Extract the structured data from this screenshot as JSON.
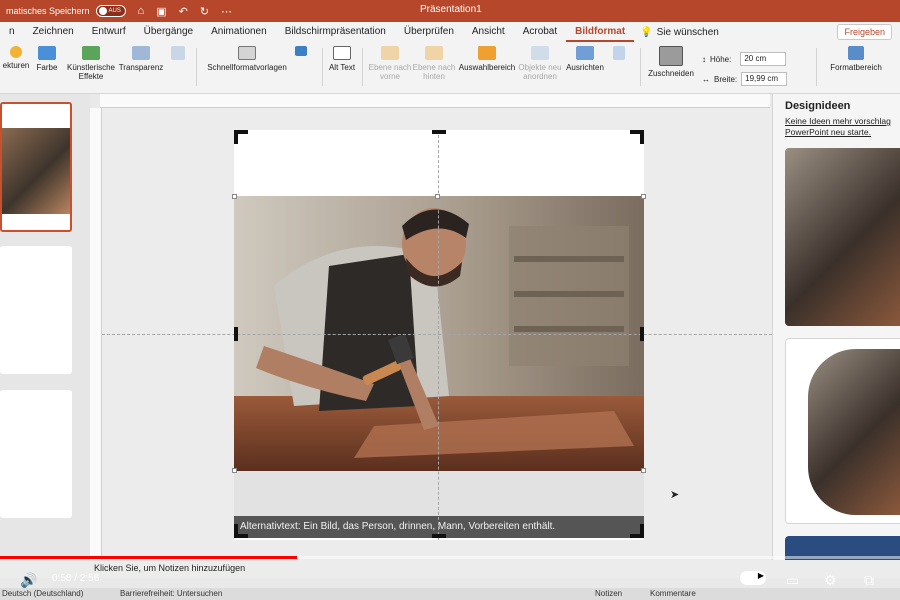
{
  "window": {
    "autosave_label": "matisches Speichern",
    "autosave_state": "AUS",
    "doc_title": "Präsentation1"
  },
  "tabs": [
    "n",
    "Zeichnen",
    "Entwurf",
    "Übergänge",
    "Animationen",
    "Bildschirmpräsentation",
    "Überprüfen",
    "Ansicht",
    "Acrobat",
    "Bildformat"
  ],
  "active_tab": "Bildformat",
  "help_label": "Sie wünschen",
  "share_label": "Freigeben",
  "ribbon": {
    "korrekturen": "ekturen",
    "farbe": "Farbe",
    "effekte": "Künstlerische Effekte",
    "transparenz": "Transparenz",
    "schnellformat": "Schnellformatvorlagen",
    "alt_text": "Alt Text",
    "ebene_vorne": "Ebene nach vorne",
    "ebene_hinten": "Ebene nach hinten",
    "auswahlbereich": "Auswahlbereich",
    "objekte_anordnen": "Objekte neu anordnen",
    "ausrichten": "Ausrichten",
    "zuschneiden": "Zuschneiden",
    "hoehe_label": "Höhe:",
    "hoehe_value": "20 cm",
    "breite_label": "Breite:",
    "breite_value": "19,99 cm",
    "formatbereich": "Formatbereich"
  },
  "design_pane": {
    "title": "Designideen",
    "message": "Keine Ideen mehr vorschlag PowerPoint neu starte."
  },
  "slide": {
    "alt_text": "Alternativtext: Ein Bild, das Person, drinnen, Mann, Vorbereiten enthält."
  },
  "notes_placeholder": "Klicken Sie, um Notizen hinzuzufügen",
  "video": {
    "time": "0:58 / 2:56",
    "progress": 0.3295
  },
  "status": {
    "language": "Deutsch (Deutschland)",
    "accessibility": "Barrierefreiheit: Untersuchen",
    "notizen": "Notizen",
    "kommentare": "Kommentare"
  },
  "colors": {
    "accent": "#b7472a",
    "progress": "#ff0000"
  }
}
